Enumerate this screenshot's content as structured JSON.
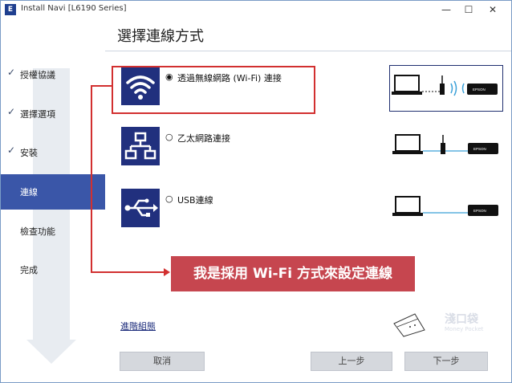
{
  "window": {
    "title": "Install Navi [L6190 Series]",
    "app_icon_letter": "E",
    "minimize": "—",
    "maximize": "☐",
    "close": "✕"
  },
  "sidebar": {
    "items": [
      {
        "label": "授權協議",
        "completed": true
      },
      {
        "label": "選擇選項",
        "completed": true
      },
      {
        "label": "安裝",
        "completed": true
      },
      {
        "label": "連線",
        "completed": false,
        "active": true
      },
      {
        "label": "檢查功能",
        "completed": false
      },
      {
        "label": "完成",
        "completed": false
      }
    ],
    "check_glyph": "✓"
  },
  "main": {
    "title": "選擇連線方式",
    "options": [
      {
        "label": "透過無線網路 (Wi-Fi) 連接",
        "icon": "wifi-icon",
        "selected": true,
        "radio_glyph": "◉"
      },
      {
        "label": "乙太網路連接",
        "icon": "ethernet-network-icon",
        "selected": false,
        "radio_glyph": "○"
      },
      {
        "label": "USB連線",
        "icon": "usb-icon",
        "selected": false,
        "radio_glyph": "○"
      }
    ],
    "thumb_brand": "EPSON",
    "advanced_link": "進階組態"
  },
  "annotation": {
    "text": "我是採用 Wi-Fi 方式來設定連線",
    "color": "#c6464f",
    "line_color": "#d23030"
  },
  "watermark": {
    "text": "淺口袋",
    "sub": "Money Pocket"
  },
  "footer": {
    "cancel": "取消",
    "back": "上一步",
    "next": "下一步"
  },
  "colors": {
    "accent": "#3a56a8",
    "icon_bg": "#21307e"
  }
}
